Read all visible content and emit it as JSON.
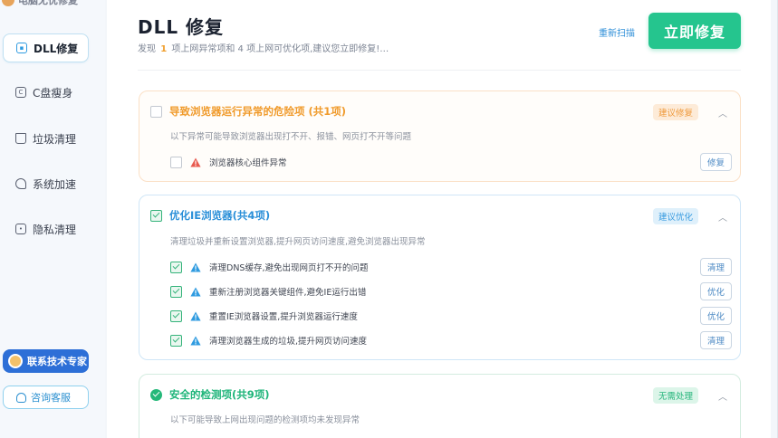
{
  "sidebar": {
    "brand": "电脑无忧修复",
    "items": [
      {
        "label": "DLL修复",
        "icon": "dll-icon"
      },
      {
        "label": "C盘瘦身",
        "icon": "disk-icon"
      },
      {
        "label": "垃圾清理",
        "icon": "trash-icon"
      },
      {
        "label": "系统加速",
        "icon": "rocket-icon"
      },
      {
        "label": "隐私清理",
        "icon": "privacy-icon"
      }
    ],
    "expert_button": "联系技术专家",
    "service_button": "咨询客服"
  },
  "header": {
    "title": "DLL 修复",
    "summary_pre": "发现",
    "summary_count1": "1",
    "summary_mid": "项上网异常项和 4 项上网可优化项,建议您立即修复!…",
    "rescan": "重新扫描",
    "repair_all": "立即修复"
  },
  "groups": [
    {
      "title": "导致浏览器运行异常的危险项 (共1项)",
      "tag": "建议修复",
      "desc": "以下异常可能导致浏览器出现打不开、报错、网页打不开等问题",
      "items": [
        {
          "label": "浏览器核心组件异常",
          "action": "修复",
          "checked": false,
          "level": "danger"
        }
      ]
    },
    {
      "title": "优化IE浏览器(共4项)",
      "tag": "建议优化",
      "desc": "清理垃圾并重新设置浏览器,提升网页访问速度,避免浏览器出现异常",
      "items": [
        {
          "label": "清理DNS缓存,避免出现网页打不开的问题",
          "action": "清理",
          "checked": true,
          "level": "info"
        },
        {
          "label": "重新注册浏览器关键组件,避免IE运行出错",
          "action": "优化",
          "checked": true,
          "level": "info"
        },
        {
          "label": "重置IE浏览器设置,提升浏览器运行速度",
          "action": "优化",
          "checked": true,
          "level": "info"
        },
        {
          "label": "清理浏览器生成的垃圾,提升网页访问速度",
          "action": "清理",
          "checked": true,
          "level": "info"
        }
      ]
    },
    {
      "title": "安全的检测项(共9项)",
      "tag": "无需处理",
      "desc": "以下可能导致上网出现问题的检测项均未发现异常"
    }
  ],
  "colors": {
    "accent": "#25c58e",
    "danger": "#f09a2a",
    "info": "#2a8fd8",
    "safe": "#1fb57a"
  }
}
